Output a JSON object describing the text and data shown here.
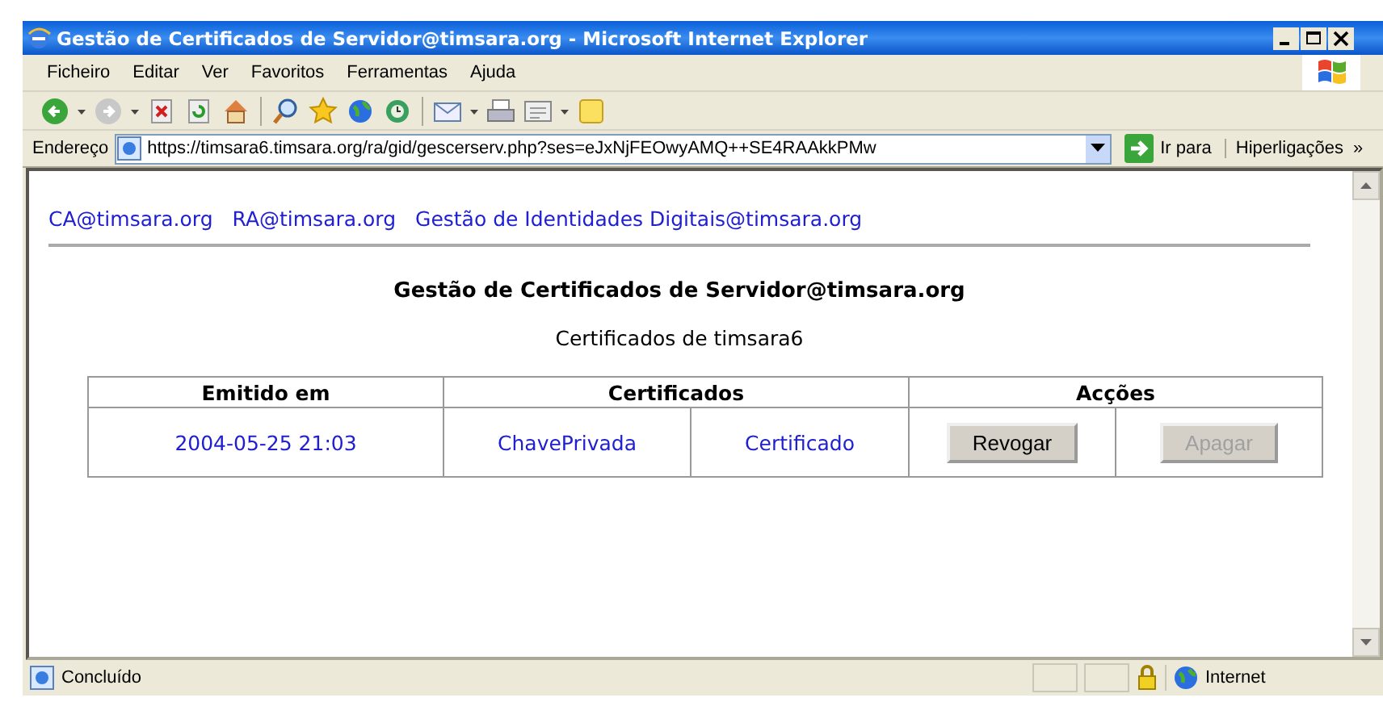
{
  "window": {
    "title": "Gestão de Certificados de Servidor@timsara.org - Microsoft Internet Explorer"
  },
  "menu": [
    {
      "label": "Ficheiro"
    },
    {
      "label": "Editar"
    },
    {
      "label": "Ver"
    },
    {
      "label": "Favoritos"
    },
    {
      "label": "Ferramentas"
    },
    {
      "label": "Ajuda"
    }
  ],
  "address_bar": {
    "label": "Endereço",
    "url": "https://timsara6.timsara.org/ra/gid/gescerserv.php?ses=eJxNjFEOwyAMQ++SE4RAAkkPMw",
    "go": "Ir para",
    "links": "Hiperligações",
    "more": "»"
  },
  "page": {
    "nav_links": [
      "CA@timsara.org",
      "RA@timsara.org",
      "Gestão de Identidades Digitais@timsara.org"
    ],
    "heading": "Gestão de Certificados de Servidor@timsara.org",
    "subheading": "Certificados de timsara6",
    "table": {
      "columns": [
        "Emitido em",
        "Certificados",
        "Acções"
      ],
      "rows": [
        {
          "issued": "2004-05-25 21:03",
          "key": "ChavePrivada",
          "certificate": "Certificado",
          "actions": [
            {
              "label": "Revogar",
              "disabled": false
            },
            {
              "label": "Apagar",
              "disabled": true
            }
          ]
        }
      ]
    }
  },
  "status_bar": {
    "text": "Concluído",
    "zone": "Internet"
  }
}
